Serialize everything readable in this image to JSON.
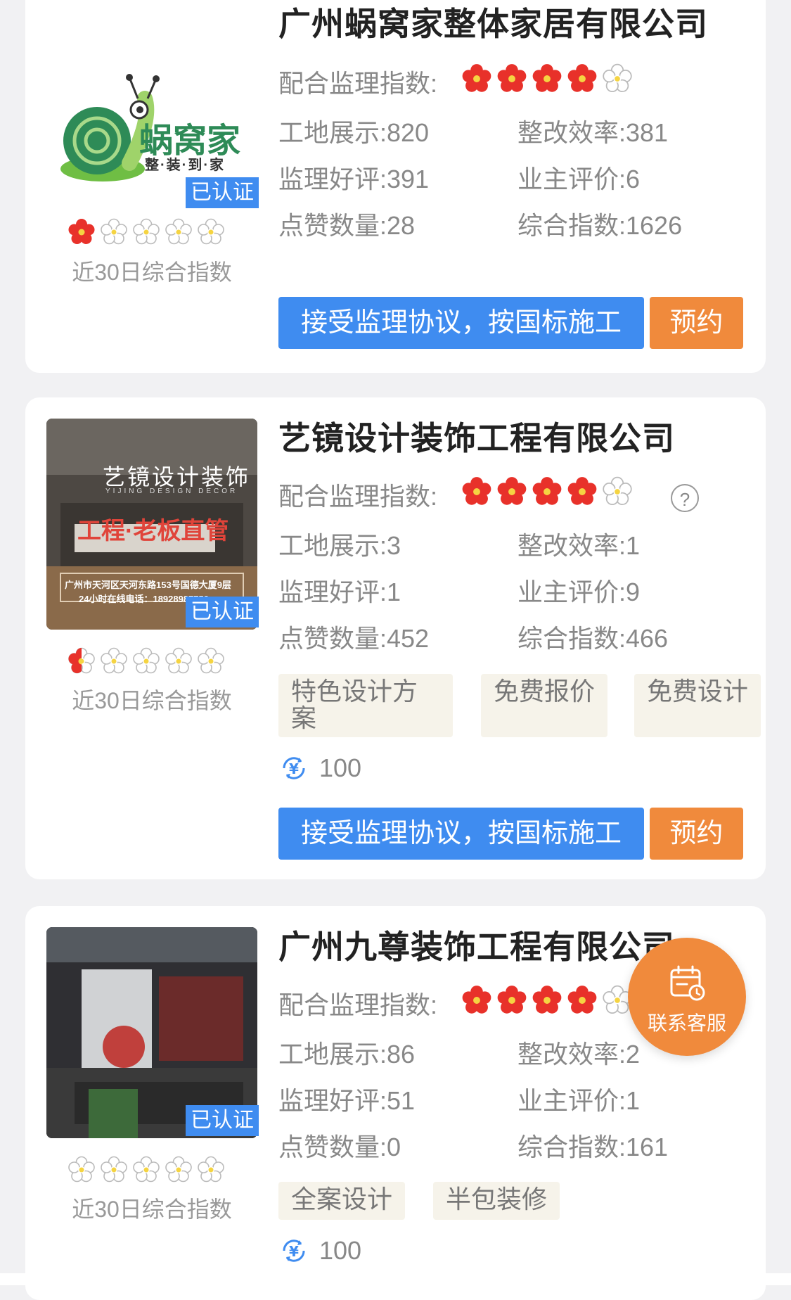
{
  "companies": [
    {
      "name": "广州蜗窝家整体家居有限公司",
      "logo_brand": "蜗窝家",
      "logo_tagline": "整·装·到·家",
      "verified": "已认证",
      "index_caption": "近30日综合指数",
      "recent_rating": 1,
      "monitor_label": "配合监理指数:",
      "monitor_rating": 4,
      "stats": {
        "site_label": "工地展示:",
        "site": "820",
        "rectify_label": "整改效率:",
        "rectify": "381",
        "praise_label": "监理好评:",
        "praise": "391",
        "owner_label": "业主评价:",
        "owner": "6",
        "likes_label": "点赞数量:",
        "likes": "28",
        "overall_label": "综合指数:",
        "overall": "1626"
      },
      "agree_button": "接受监理协议，按国标施工",
      "book_button": "预约"
    },
    {
      "name": "艺镜设计装饰工程有限公司",
      "image_title": "艺镜设计装饰",
      "image_subtitle": "YIJING DESIGN DECOR",
      "image_slogan": "工程·老板直管",
      "image_address": "广州市天河区天河东路153号国德大厦9层",
      "image_phone": "24小时在线电话：18928987753",
      "verified": "已认证",
      "index_caption": "近30日综合指数",
      "recent_rating": 0.5,
      "monitor_label": "配合监理指数:",
      "monitor_rating": 4,
      "help": "?",
      "stats": {
        "site_label": "工地展示:",
        "site": "3",
        "rectify_label": "整改效率:",
        "rectify": "1",
        "praise_label": "监理好评:",
        "praise": "1",
        "owner_label": "业主评价:",
        "owner": "9",
        "likes_label": "点赞数量:",
        "likes": "452",
        "overall_label": "综合指数:",
        "overall": "466"
      },
      "tags": [
        "特色设计方案",
        "免费报价",
        "免费设计"
      ],
      "coins": "100",
      "agree_button": "接受监理协议，按国标施工",
      "book_button": "预约"
    },
    {
      "name": "广州九尊装饰工程有限公司",
      "verified": "已认证",
      "index_caption": "近30日综合指数",
      "recent_rating": 0,
      "monitor_label": "配合监理指数:",
      "monitor_rating": 4,
      "stats": {
        "site_label": "工地展示:",
        "site": "86",
        "rectify_label": "整改效率:",
        "rectify": "2",
        "praise_label": "监理好评:",
        "praise": "51",
        "owner_label": "业主评价:",
        "owner": "1",
        "likes_label": "点赞数量:",
        "likes": "0",
        "overall_label": "综合指数:",
        "overall": "161"
      },
      "tags": [
        "全案设计",
        "半包装修"
      ],
      "coins": "100"
    }
  ],
  "fab": {
    "label": "联系客服",
    "icon": "calendar-clock-icon"
  },
  "colors": {
    "primary": "#3f8cf0",
    "accent": "#f08a3c",
    "flower_red": "#e8312a"
  }
}
